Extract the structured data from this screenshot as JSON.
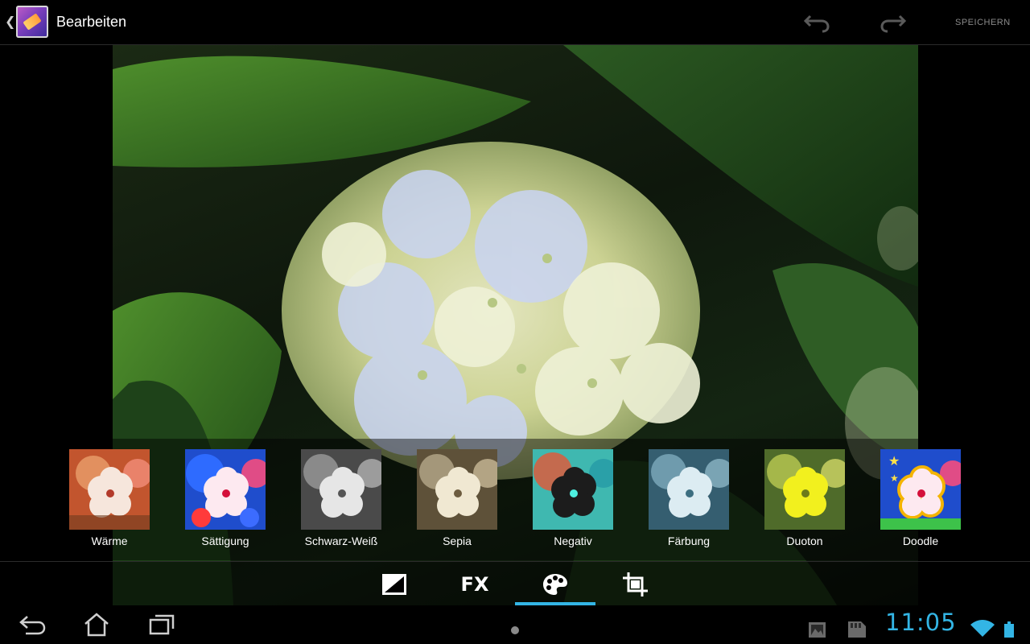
{
  "action_bar": {
    "title": "Bearbeiten",
    "save_label": "SPEICHERN"
  },
  "filters": [
    {
      "label": "Wärme"
    },
    {
      "label": "Sättigung"
    },
    {
      "label": "Schwarz-Weiß"
    },
    {
      "label": "Sepia"
    },
    {
      "label": "Negativ"
    },
    {
      "label": "Färbung"
    },
    {
      "label": "Duoton"
    },
    {
      "label": "Doodle"
    }
  ],
  "tools": [
    {
      "icon": "exposure-icon"
    },
    {
      "label": "FX"
    },
    {
      "icon": "palette-icon",
      "active": true
    },
    {
      "icon": "crop-icon"
    }
  ],
  "status_bar": {
    "time": "11:05"
  },
  "colors": {
    "accent": "#33b5e5"
  }
}
